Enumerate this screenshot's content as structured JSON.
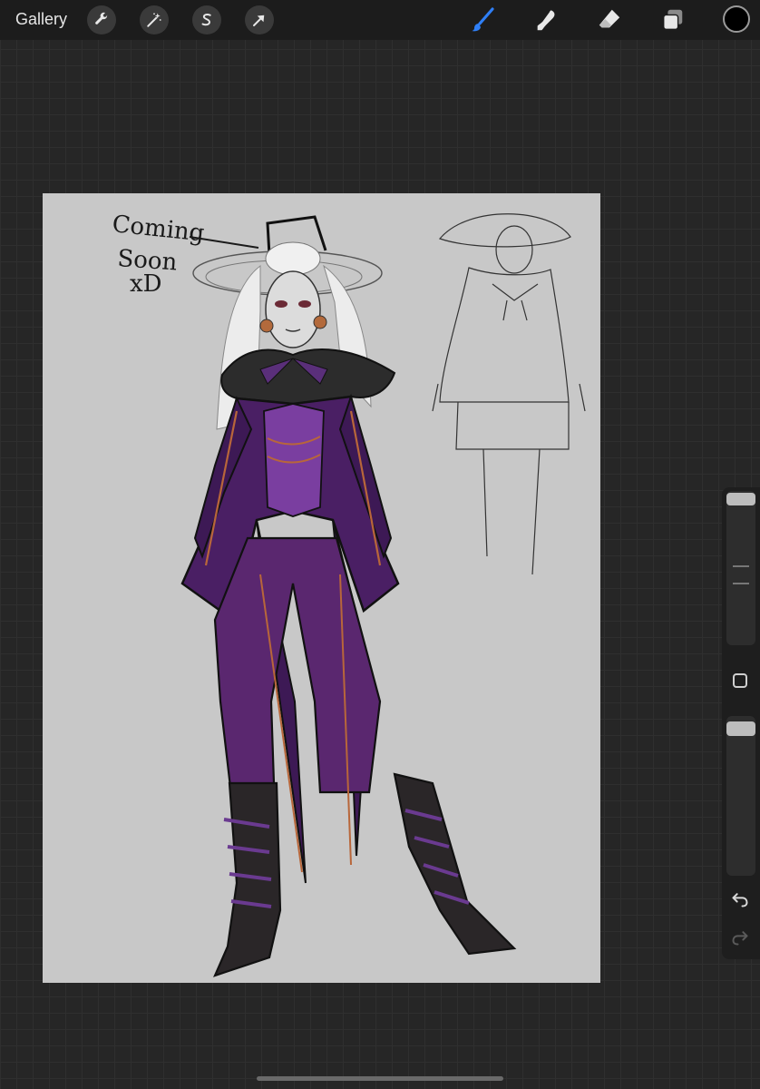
{
  "toolbar": {
    "gallery_label": "Gallery",
    "left_tools": [
      "wrench-icon",
      "magic-wand-icon",
      "selection-s-icon",
      "transform-arrow-icon"
    ],
    "right_tools": [
      "brush-icon",
      "smudge-icon",
      "eraser-icon",
      "layers-icon"
    ],
    "active_tool": "brush-icon",
    "current_color": "#000000",
    "accent_color": "#2f7ff6"
  },
  "canvas": {
    "note_line1": "Coming",
    "note_line2": "Soon",
    "note_line3": "xD"
  },
  "sidebar": {
    "icons": [
      "modify-square-icon",
      "undo-icon",
      "redo-icon"
    ]
  }
}
